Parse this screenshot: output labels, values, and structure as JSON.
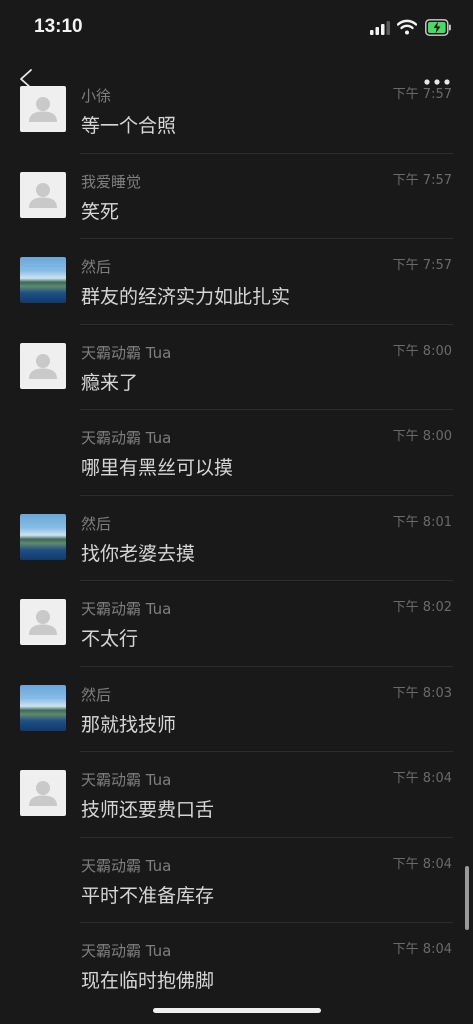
{
  "status": {
    "time": "13:10"
  },
  "colors": {
    "background": "#191919",
    "name": "#7e7e7e",
    "text": "#d6d6d6",
    "battery_fill": "#4cd964"
  },
  "messages": [
    {
      "name": "小徐",
      "time": "下午 7:57",
      "text": "等一个合照",
      "avatar": "default"
    },
    {
      "name": "我爱睡觉",
      "time": "下午 7:57",
      "text": "笑死",
      "avatar": "default"
    },
    {
      "name": "然后",
      "time": "下午 7:57",
      "text": "群友的经济实力如此扎实",
      "avatar": "photo"
    },
    {
      "name": "天霸动霸 Tua",
      "time": "下午 8:00",
      "text": "瘾来了",
      "avatar": "default"
    },
    {
      "name": "天霸动霸 Tua",
      "time": "下午 8:00",
      "text": "哪里有黑丝可以摸",
      "avatar": "none"
    },
    {
      "name": "然后",
      "time": "下午 8:01",
      "text": "找你老婆去摸",
      "avatar": "photo"
    },
    {
      "name": "天霸动霸 Tua",
      "time": "下午 8:02",
      "text": "不太行",
      "avatar": "default"
    },
    {
      "name": "然后",
      "time": "下午 8:03",
      "text": "那就找技师",
      "avatar": "photo"
    },
    {
      "name": "天霸动霸 Tua",
      "time": "下午 8:04",
      "text": "技师还要费口舌",
      "avatar": "default"
    },
    {
      "name": "天霸动霸 Tua",
      "time": "下午 8:04",
      "text": "平时不准备库存",
      "avatar": "none"
    },
    {
      "name": "天霸动霸 Tua",
      "time": "下午 8:04",
      "text": "现在临时抱佛脚",
      "avatar": "none"
    }
  ],
  "icons": [
    "back-arrow-icon",
    "more-icon",
    "cellular-signal-icon",
    "wifi-icon",
    "battery-charging-icon",
    "default-avatar-icon"
  ]
}
